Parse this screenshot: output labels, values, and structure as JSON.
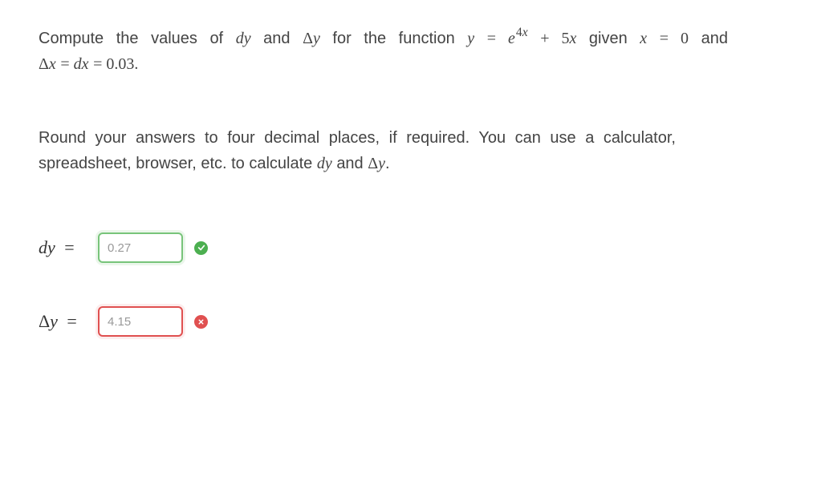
{
  "problem": {
    "line1_a": "Compute the values of ",
    "dy_math": "dy",
    "line1_b": " and ",
    "Dy_math": "Δy",
    "line1_c": " for the function ",
    "func_y": "y",
    "eq": " = ",
    "e_base": "e",
    "exp_val": "4x",
    "plus5x": " + 5x",
    "given": " given ",
    "x_var": "x",
    "zero": "0",
    "and": " and",
    "line2_a": "Δx",
    "line2_b": "dx",
    "line2_c": "0.03."
  },
  "instructions": {
    "line1": "Round your answers to four decimal places, if required. You can use a calculator,",
    "line2_a": "spreadsheet, browser, etc. to calculate ",
    "dy": "dy",
    "and2": " and ",
    "Dy": "Δy",
    "period": "."
  },
  "answers": {
    "dy": {
      "label": "dy",
      "value": "0.27",
      "status": "correct"
    },
    "Dy": {
      "label": "Δy",
      "value": "4.15",
      "status": "incorrect"
    }
  }
}
